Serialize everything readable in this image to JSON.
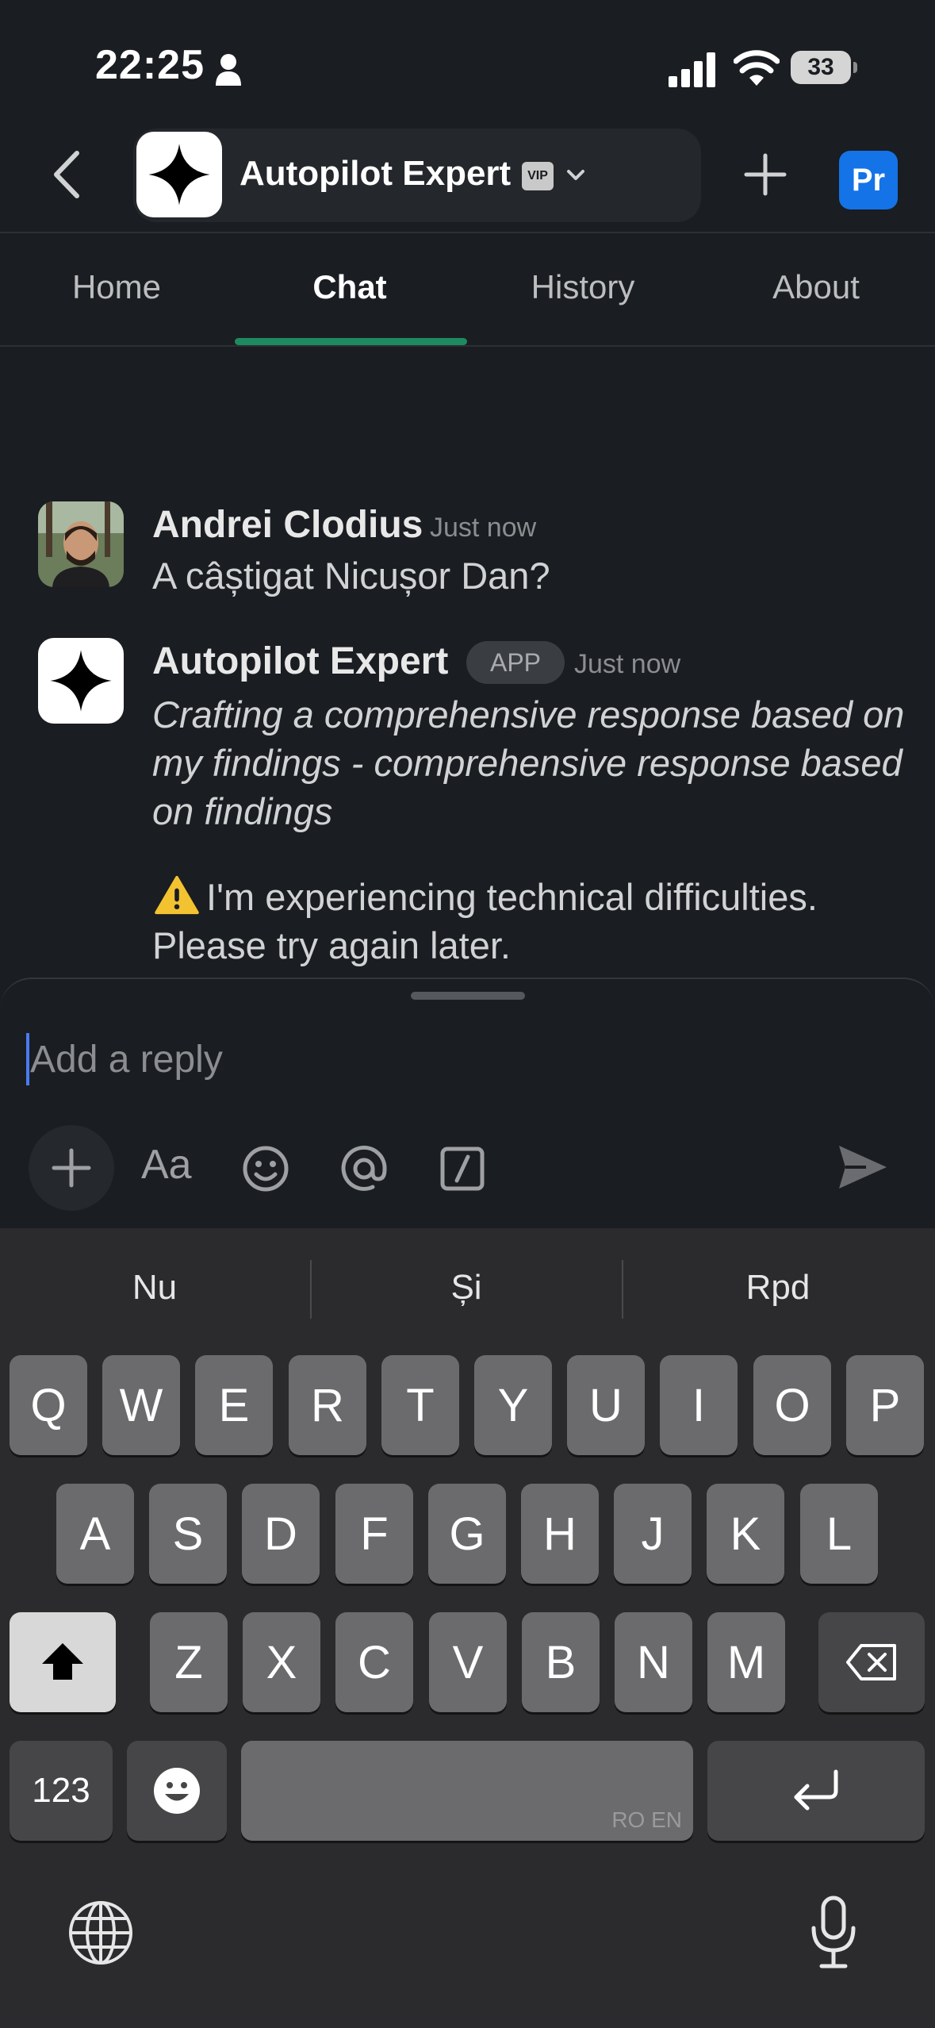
{
  "status_bar": {
    "time": "22:25",
    "battery": "33"
  },
  "header": {
    "title": "Autopilot Expert",
    "badge": "VIP",
    "avatar_initials": "Pr"
  },
  "tabs": [
    {
      "label": "Home"
    },
    {
      "label": "Chat",
      "active": true
    },
    {
      "label": "History"
    },
    {
      "label": "About"
    }
  ],
  "messages": [
    {
      "author": "Andrei Clodius",
      "time": "Just now",
      "text": "A câștigat Nicușor Dan?"
    },
    {
      "author": "Autopilot Expert",
      "badge": "APP",
      "time": "Just now",
      "text": "Crafting a comprehensive response based on my findings - comprehensive response based on findings",
      "warning": "I'm experiencing technical difficulties. Please try again later."
    }
  ],
  "composer": {
    "placeholder": "Add a reply",
    "format_label": "Aa"
  },
  "keyboard": {
    "suggestions": [
      "Nu",
      "Și",
      "Rpd"
    ],
    "row1": [
      "Q",
      "W",
      "E",
      "R",
      "T",
      "Y",
      "U",
      "I",
      "O",
      "P"
    ],
    "row2": [
      "A",
      "S",
      "D",
      "F",
      "G",
      "H",
      "J",
      "K",
      "L"
    ],
    "row3": [
      "Z",
      "X",
      "C",
      "V",
      "B",
      "N",
      "M"
    ],
    "numbers_key": "123",
    "space_languages": "RO EN"
  },
  "colors": {
    "tab_indicator": "#1e8a5f",
    "avatar_bg": "#1473e6",
    "cursor": "#4a7cf0"
  }
}
